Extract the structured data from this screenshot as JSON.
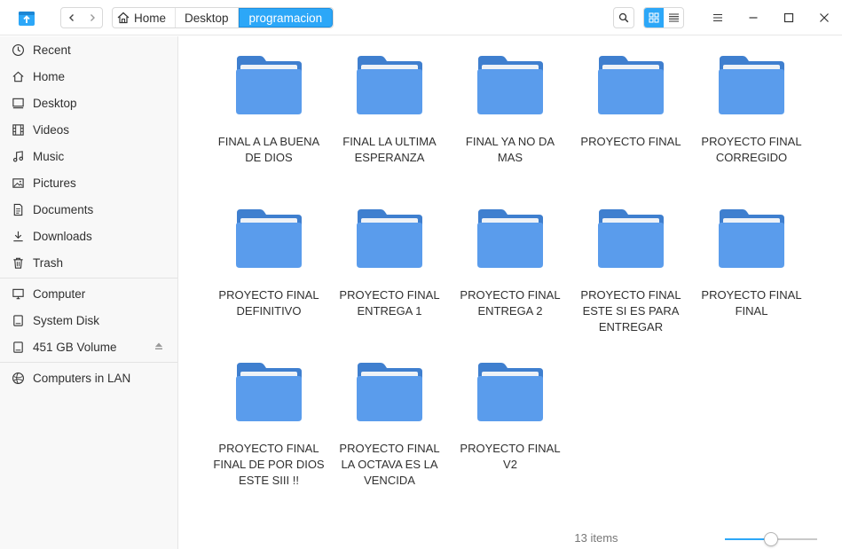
{
  "titlebar": {
    "breadcrumbs": [
      "Home",
      "Desktop",
      "programacion"
    ],
    "accent_color": "#2ca7f8"
  },
  "sidebar": {
    "items": [
      {
        "label": "Recent",
        "icon": "clock-icon"
      },
      {
        "label": "Home",
        "icon": "home-icon"
      },
      {
        "label": "Desktop",
        "icon": "desktop-icon"
      },
      {
        "label": "Videos",
        "icon": "film-icon"
      },
      {
        "label": "Music",
        "icon": "music-icon"
      },
      {
        "label": "Pictures",
        "icon": "image-icon"
      },
      {
        "label": "Documents",
        "icon": "document-icon"
      },
      {
        "label": "Downloads",
        "icon": "download-icon"
      },
      {
        "label": "Trash",
        "icon": "trash-icon"
      },
      {
        "label": "Computer",
        "icon": "computer-icon"
      },
      {
        "label": "System Disk",
        "icon": "disk-icon"
      },
      {
        "label": "451 GB Volume",
        "icon": "disk-icon"
      },
      {
        "label": "Computers in LAN",
        "icon": "network-icon"
      }
    ]
  },
  "files": [
    {
      "name": "FINAL A LA BUENA DE DIOS"
    },
    {
      "name": "FINAL LA ULTIMA ESPERANZA"
    },
    {
      "name": "FINAL YA NO DA MAS"
    },
    {
      "name": "PROYECTO FINAL"
    },
    {
      "name": "PROYECTO FINAL CORREGIDO"
    },
    {
      "name": "PROYECTO FINAL DEFINITIVO"
    },
    {
      "name": "PROYECTO FINAL ENTREGA 1"
    },
    {
      "name": "PROYECTO FINAL ENTREGA 2"
    },
    {
      "name": "PROYECTO FINAL ESTE SI ES PARA ENTREGAR"
    },
    {
      "name": "PROYECTO FINAL FINAL"
    },
    {
      "name": "PROYECTO FINAL FINAL DE POR DIOS ESTE SIII !!"
    },
    {
      "name": "PROYECTO FINAL LA OCTAVA ES LA VENCIDA"
    },
    {
      "name": "PROYECTO FINAL V2"
    }
  ],
  "status": {
    "item_count": "13 items",
    "zoom_level": 0.5
  }
}
